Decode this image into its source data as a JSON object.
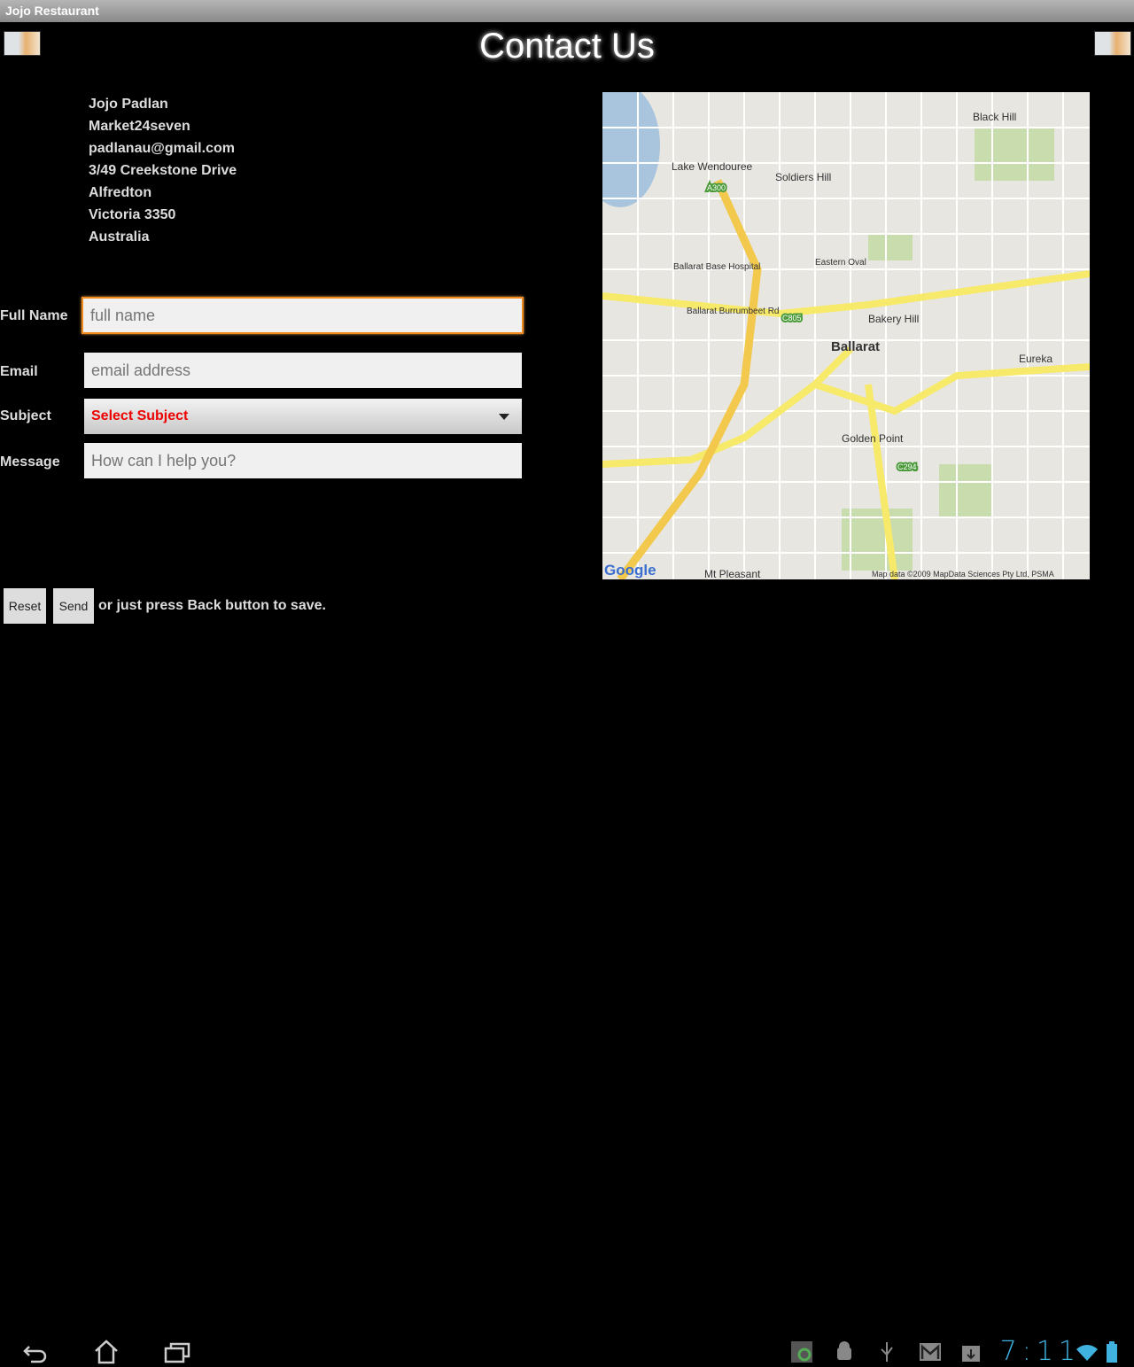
{
  "app": {
    "title": "Jojo Restaurant"
  },
  "page": {
    "heading": "Contact Us"
  },
  "address": [
    "Jojo Padlan",
    "Market24seven",
    "padlanau@gmail.com",
    "3/49 Creekstone Drive",
    "Alfredton",
    "Victoria 3350",
    "Australia"
  ],
  "form": {
    "full_name": {
      "label": "Full Name",
      "placeholder": "full name"
    },
    "email": {
      "label": "Email",
      "placeholder": "email address"
    },
    "subject": {
      "label": "Subject",
      "selected": "Select Subject"
    },
    "message": {
      "label": "Message",
      "placeholder": "How can I help you?"
    }
  },
  "buttons": {
    "reset": "Reset",
    "send": "Send",
    "note": "or just press Back button to save."
  },
  "map": {
    "labels": [
      "Ballarat",
      "Bakery Hill",
      "Soldiers Hill",
      "Lake Wendouree",
      "Black Hill",
      "Eureka",
      "Golden Point",
      "Mt Pleasant",
      "Ballarat Burrumbeet Rd",
      "Eastern Oval",
      "Ballarat Base Hospital"
    ],
    "road_badges": [
      "A300",
      "C805",
      "C294"
    ],
    "attribution": "Map data ©2009 MapData Sciences Pty Ltd, PSMA",
    "logo": "Google",
    "road_color": "#f7e96a",
    "highway_color": "#f2c94c",
    "water_color": "#a9c4dd",
    "park_color": "#c8dcae"
  },
  "status": {
    "time": "7:11",
    "accent": "#3fb2e0"
  }
}
